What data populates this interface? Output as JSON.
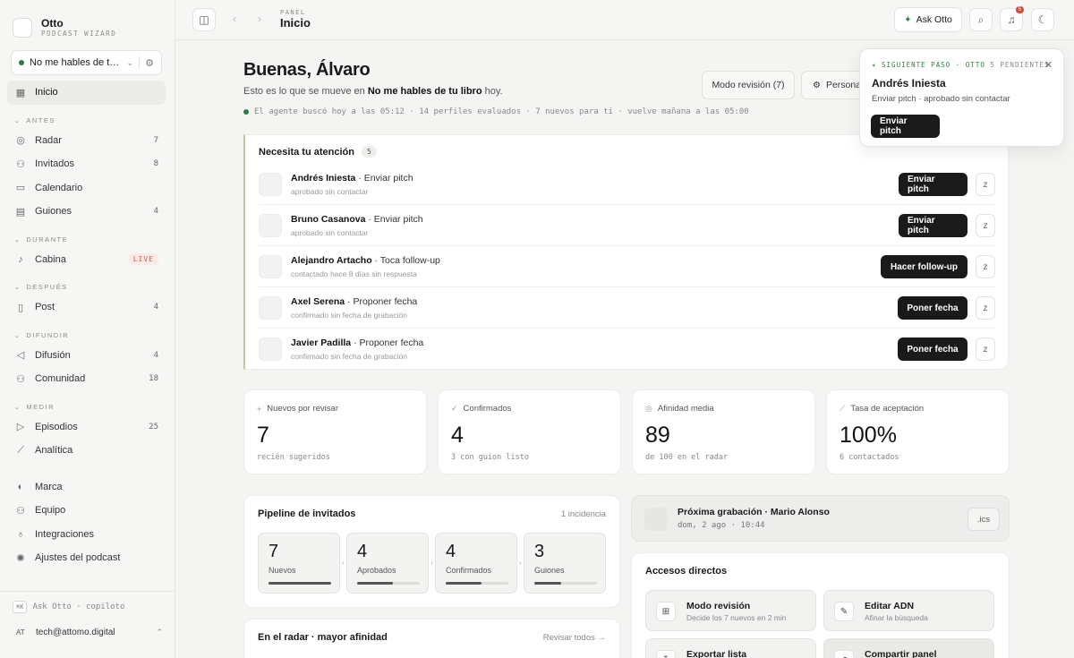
{
  "brand": {
    "name": "Otto",
    "subtitle": "PODCAST WIZARD"
  },
  "podcast_selector": {
    "name": "No me hables de tu l...",
    "status_color": "#2e7d46"
  },
  "nav": {
    "home": {
      "label": "Inicio"
    },
    "sections": [
      {
        "title": "ANTES",
        "items": [
          {
            "label": "Radar",
            "count": "7",
            "icon": "radar-icon"
          },
          {
            "label": "Invitados",
            "count": "8",
            "icon": "users-icon"
          },
          {
            "label": "Calendario",
            "count": "",
            "icon": "calendar-icon"
          },
          {
            "label": "Guiones",
            "count": "4",
            "icon": "script-icon"
          }
        ]
      },
      {
        "title": "DURANTE",
        "items": [
          {
            "label": "Cabina",
            "badge": "LIVE",
            "icon": "mic-icon"
          }
        ]
      },
      {
        "title": "DESPUÉS",
        "items": [
          {
            "label": "Post",
            "count": "4",
            "icon": "document-icon"
          }
        ]
      },
      {
        "title": "DIFUNDIR",
        "items": [
          {
            "label": "Difusión",
            "count": "4",
            "icon": "megaphone-icon"
          },
          {
            "label": "Comunidad",
            "count": "18",
            "icon": "community-icon"
          }
        ]
      },
      {
        "title": "MEDIR",
        "items": [
          {
            "label": "Episodios",
            "count": "25",
            "icon": "play-icon"
          },
          {
            "label": "Analítica",
            "count": "",
            "icon": "chart-icon"
          }
        ]
      }
    ],
    "footer_items": [
      {
        "label": "Marca",
        "icon": "palette-icon"
      },
      {
        "label": "Equipo",
        "icon": "team-icon"
      },
      {
        "label": "Integraciones",
        "icon": "plug-icon"
      },
      {
        "label": "Ajustes del podcast",
        "icon": "gear-icon"
      }
    ]
  },
  "sidebar_bottom": {
    "kbd": "⌘K",
    "ask_text": "Ask Otto · copiloto",
    "avatar": "AT",
    "email": "tech@attomo.digital"
  },
  "topbar": {
    "crumb_sub": "PANEL",
    "crumb_title": "Inicio",
    "ask_label": "Ask Otto",
    "bell_badge": "5"
  },
  "greeting": {
    "title": "Buenas, Álvaro",
    "sub_prefix": "Esto es lo que se mueve en",
    "sub_bold": "No me hables de tu libro",
    "sub_suffix": "hoy.",
    "agent_line": "El agente buscó hoy a las 05:12 · 14 perfiles evaluados · 7 nuevos para ti · vuelve mañana a las 05:00"
  },
  "header_buttons": {
    "review": "Modo revisión (7)",
    "personalize": "Persona"
  },
  "attention": {
    "title": "Necesita tu atención",
    "count": "5",
    "rows": [
      {
        "name": "Andrés Iniesta",
        "action": "· Enviar pitch",
        "sub": "aprobado sin contactar",
        "button": "Enviar pitch"
      },
      {
        "name": "Bruno Casanova",
        "action": "· Enviar pitch",
        "sub": "aprobado sin contactar",
        "button": "Enviar pitch"
      },
      {
        "name": "Alejandro Artacho",
        "action": "· Toca follow-up",
        "sub": "contactado hace 8 días sin respuesta",
        "button": "Hacer follow-up"
      },
      {
        "name": "Axel Serena",
        "action": "· Proponer fecha",
        "sub": "confirmado sin fecha de grabación",
        "button": "Poner fecha"
      },
      {
        "name": "Javier Padilla",
        "action": "· Proponer fecha",
        "sub": "confirmado sin fecha de grabación",
        "button": "Poner fecha"
      }
    ]
  },
  "stats": [
    {
      "label": "Nuevos por revisar",
      "value": "7",
      "sub": "recién sugeridos",
      "icon": "plus-icon"
    },
    {
      "label": "Confirmados",
      "value": "4",
      "sub": "3 con guion listo",
      "icon": "check-icon"
    },
    {
      "label": "Afinidad media",
      "value": "89",
      "sub": "de 100 en el radar",
      "icon": "target-icon"
    },
    {
      "label": "Tasa de aceptación",
      "value": "100%",
      "sub": "6 contactados",
      "icon": "trend-icon"
    }
  ],
  "pipeline": {
    "title": "Pipeline de invitados",
    "aside": "1 incidencia",
    "stages": [
      {
        "value": "7",
        "label": "Nuevos",
        "fill": 1.0
      },
      {
        "value": "4",
        "label": "Aprobados",
        "fill": 0.57
      },
      {
        "value": "4",
        "label": "Confirmados",
        "fill": 0.57
      },
      {
        "value": "3",
        "label": "Guiones",
        "fill": 0.43
      }
    ]
  },
  "radar_card": {
    "title": "En el radar · mayor afinidad",
    "aside": "Revisar todos →"
  },
  "next_recording": {
    "title": "Próxima grabación · Mario Alonso",
    "sub": "dom, 2 ago · 10:44",
    "button": ".ics"
  },
  "shortcuts": {
    "title": "Accesos directos",
    "items": [
      {
        "title": "Modo revisión",
        "sub": "Decide los 7 nuevos en 2 min",
        "icon": "review-icon"
      },
      {
        "title": "Editar ADN",
        "sub": "Afinar la búsqueda",
        "icon": "pencil-icon"
      },
      {
        "title": "Exportar lista",
        "sub": "",
        "icon": "export-icon"
      },
      {
        "title": "Compartir panel",
        "sub": "",
        "icon": "share-icon"
      }
    ]
  },
  "popover": {
    "kicker": "SIGUIENTE PASO · OTTO",
    "pending": "5 PENDIENTES",
    "name": "Andrés Iniesta",
    "sub": "Enviar pitch · aprobado sin contactar",
    "button": "Enviar pitch"
  },
  "colors": {
    "accent_green": "#2e7d46",
    "live_red": "#d05a4a",
    "dark_button": "#1a1a1a"
  }
}
